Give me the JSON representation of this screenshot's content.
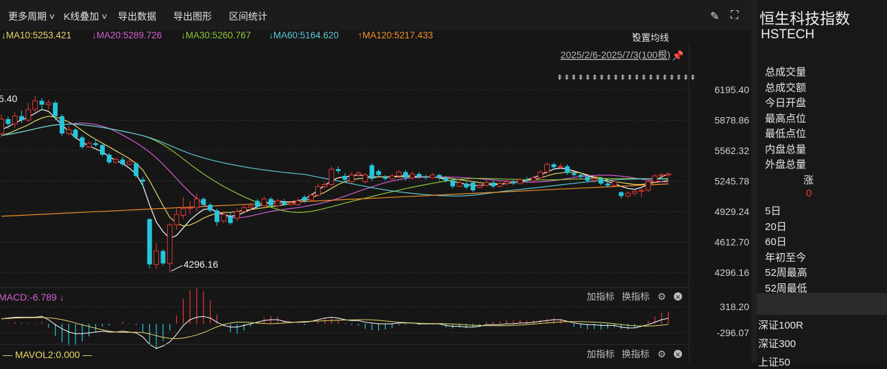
{
  "toolbar": {
    "more_period": "更多周期",
    "kline_overlay": "K线叠加",
    "export_data": "导出数据",
    "export_chart": "导出图形",
    "range_stats": "区间统计"
  },
  "ma_legend": [
    {
      "label": "MA10:5253.421",
      "arrow": "↓",
      "color": "#e8d86a"
    },
    {
      "label": "MA20:5289.726",
      "arrow": "↓",
      "color": "#d45fd4"
    },
    {
      "label": "MA30:5260.767",
      "arrow": "↓",
      "color": "#8fc63a"
    },
    {
      "label": "MA60:5164.620",
      "arrow": "↓",
      "color": "#5cc8d6"
    },
    {
      "label": "MA120:5217.433",
      "arrow": "↑",
      "color": "#f0902a"
    }
  ],
  "settings_ma": "设置均线",
  "date_range": "2025/2/6-2025/7/3(100根)",
  "marker_row": "⇞⇞⇞⇞⇞⇞⇞⇞⇞⇞⇞⇞⇞⇞⇞⇞⇞⇞⇞⇞",
  "chart_data": {
    "type": "candlestick",
    "y_ticks": [
      "6195.40",
      "5878.86",
      "5562.32",
      "5245.78",
      "4929.24",
      "4612.70",
      "4296.16"
    ],
    "ylim": [
      4296.16,
      6195.4
    ],
    "high_label": "5.40",
    "low_label": "4296.16",
    "candles": [
      [
        5740,
        5890,
        5940,
        5700
      ],
      [
        5890,
        5840,
        5920,
        5790
      ],
      [
        5840,
        5920,
        5960,
        5800
      ],
      [
        5920,
        5880,
        5980,
        5850
      ],
      [
        5880,
        5990,
        6060,
        5860
      ],
      [
        5990,
        6080,
        6130,
        5960
      ],
      [
        6080,
        6040,
        6110,
        5990
      ],
      [
        6040,
        6060,
        6090,
        5990
      ],
      [
        6060,
        5920,
        6080,
        5880
      ],
      [
        5920,
        5740,
        5940,
        5710
      ],
      [
        5740,
        5780,
        5820,
        5720
      ],
      [
        5780,
        5700,
        5800,
        5680
      ],
      [
        5700,
        5600,
        5720,
        5580
      ],
      [
        5600,
        5640,
        5660,
        5590
      ],
      [
        5640,
        5620,
        5680,
        5600
      ],
      [
        5620,
        5520,
        5640,
        5500
      ],
      [
        5520,
        5440,
        5540,
        5420
      ],
      [
        5440,
        5470,
        5490,
        5430
      ],
      [
        5470,
        5420,
        5500,
        5400
      ],
      [
        5420,
        5450,
        5480,
        5410
      ],
      [
        5430,
        5300,
        5440,
        5280
      ],
      [
        5260,
        5240,
        5290,
        5180
      ],
      [
        4850,
        4380,
        4860,
        4340
      ],
      [
        4380,
        4520,
        4600,
        4330
      ],
      [
        4520,
        4390,
        4540,
        4370
      ],
      [
        4390,
        4790,
        4810,
        4296
      ],
      [
        4790,
        4900,
        4960,
        4740
      ],
      [
        4890,
        4960,
        5080,
        4850
      ],
      [
        4960,
        4970,
        5040,
        4900
      ],
      [
        4970,
        5060,
        5120,
        4930
      ],
      [
        5060,
        5000,
        5080,
        4980
      ],
      [
        5000,
        4940,
        5020,
        4920
      ],
      [
        4940,
        4820,
        4960,
        4780
      ],
      [
        4830,
        4900,
        4930,
        4810
      ],
      [
        4880,
        4810,
        4920,
        4790
      ],
      [
        4860,
        4930,
        4960,
        4830
      ],
      [
        4930,
        4970,
        5010,
        4920
      ],
      [
        4970,
        4990,
        5020,
        4940
      ],
      [
        5040,
        4980,
        5060,
        4960
      ],
      [
        4990,
        5060,
        5090,
        4960
      ],
      [
        5060,
        4990,
        5080,
        4980
      ],
      [
        4990,
        5040,
        5060,
        4970
      ],
      [
        5030,
        5000,
        5060,
        4990
      ],
      [
        5000,
        5020,
        5040,
        4990
      ],
      [
        5000,
        5040,
        5070,
        4990
      ],
      [
        5080,
        5040,
        5100,
        5020
      ],
      [
        5050,
        5100,
        5120,
        5030
      ],
      [
        5100,
        5190,
        5220,
        5080
      ],
      [
        5190,
        5210,
        5240,
        5170
      ],
      [
        5210,
        5370,
        5400,
        5190
      ],
      [
        5370,
        5350,
        5400,
        5320
      ],
      [
        5300,
        5260,
        5330,
        5240
      ],
      [
        5240,
        5310,
        5340,
        5220
      ],
      [
        5310,
        5330,
        5350,
        5290
      ],
      [
        5240,
        5310,
        5330,
        5220
      ],
      [
        5410,
        5270,
        5430,
        5250
      ],
      [
        5350,
        5310,
        5370,
        5290
      ],
      [
        5290,
        5270,
        5310,
        5250
      ],
      [
        5270,
        5300,
        5320,
        5250
      ],
      [
        5300,
        5340,
        5360,
        5280
      ],
      [
        5340,
        5280,
        5360,
        5250
      ],
      [
        5280,
        5320,
        5340,
        5260
      ],
      [
        5320,
        5290,
        5340,
        5270
      ],
      [
        5290,
        5280,
        5310,
        5260
      ],
      [
        5280,
        5310,
        5330,
        5270
      ],
      [
        5310,
        5280,
        5320,
        5250
      ],
      [
        5280,
        5250,
        5300,
        5230
      ],
      [
        5250,
        5190,
        5270,
        5170
      ],
      [
        5190,
        5230,
        5250,
        5180
      ],
      [
        5220,
        5180,
        5240,
        5160
      ],
      [
        5230,
        5150,
        5240,
        5130
      ],
      [
        5180,
        5200,
        5220,
        5170
      ],
      [
        5200,
        5230,
        5260,
        5190
      ],
      [
        5230,
        5190,
        5250,
        5170
      ],
      [
        5190,
        5220,
        5240,
        5180
      ],
      [
        5220,
        5240,
        5260,
        5200
      ],
      [
        5240,
        5220,
        5260,
        5200
      ],
      [
        5220,
        5260,
        5280,
        5210
      ],
      [
        5260,
        5250,
        5290,
        5230
      ],
      [
        5250,
        5280,
        5300,
        5240
      ],
      [
        5280,
        5340,
        5360,
        5270
      ],
      [
        5340,
        5420,
        5440,
        5320
      ],
      [
        5420,
        5390,
        5440,
        5370
      ],
      [
        5390,
        5400,
        5430,
        5380
      ],
      [
        5400,
        5330,
        5420,
        5310
      ],
      [
        5330,
        5310,
        5350,
        5290
      ],
      [
        5310,
        5290,
        5330,
        5270
      ],
      [
        5290,
        5250,
        5310,
        5230
      ],
      [
        5250,
        5270,
        5290,
        5230
      ],
      [
        5270,
        5220,
        5290,
        5200
      ],
      [
        5220,
        5200,
        5240,
        5180
      ],
      [
        5200,
        5240,
        5260,
        5180
      ],
      [
        5130,
        5090,
        5140,
        5060
      ],
      [
        5090,
        5120,
        5140,
        5070
      ],
      [
        5120,
        5140,
        5160,
        5090
      ],
      [
        5140,
        5150,
        5170,
        5080
      ],
      [
        5150,
        5240,
        5270,
        5130
      ],
      [
        5240,
        5300,
        5320,
        5220
      ],
      [
        5300,
        5310,
        5330,
        5280
      ],
      [
        5310,
        5320,
        5340,
        5290
      ]
    ],
    "ma_series": {
      "MA5": [
        5780,
        5810,
        5850,
        5880,
        5910,
        5950,
        5990,
        5970,
        5900,
        5830,
        5760,
        5700,
        5650,
        5610,
        5580,
        5550,
        5500,
        5460,
        5430,
        5380,
        5320,
        5200,
        5000,
        4820,
        4720,
        4650,
        4680,
        4760,
        4840,
        4900,
        4950,
        4960,
        4930,
        4900,
        4880,
        4890,
        4920,
        4950,
        4980,
        5010,
        5030,
        5040,
        5030,
        5030,
        5040,
        5060,
        5100,
        5150,
        5200,
        5250,
        5280,
        5290,
        5300,
        5310,
        5300,
        5290,
        5290,
        5290,
        5290,
        5300,
        5300,
        5300,
        5290,
        5290,
        5290,
        5280,
        5260,
        5240,
        5230,
        5210,
        5200,
        5200,
        5210,
        5210,
        5210,
        5220,
        5230,
        5250,
        5260,
        5280,
        5310,
        5340,
        5370,
        5380,
        5370,
        5350,
        5330,
        5300,
        5280,
        5260,
        5240,
        5220,
        5190,
        5170,
        5160,
        5180,
        5210,
        5250,
        5290,
        5320
      ],
      "MA10": [
        5720,
        5740,
        5770,
        5800,
        5830,
        5870,
        5900,
        5920,
        5910,
        5890,
        5860,
        5820,
        5770,
        5720,
        5680,
        5640,
        5600,
        5560,
        5520,
        5480,
        5430,
        5360,
        5250,
        5120,
        4990,
        4870,
        4810,
        4780,
        4790,
        4820,
        4860,
        4890,
        4910,
        4920,
        4920,
        4930,
        4940,
        4950,
        4960,
        4970,
        4980,
        4990,
        5000,
        5010,
        5020,
        5040,
        5070,
        5100,
        5130,
        5170,
        5210,
        5240,
        5260,
        5270,
        5280,
        5280,
        5290,
        5290,
        5290,
        5290,
        5290,
        5290,
        5290,
        5290,
        5290,
        5280,
        5280,
        5270,
        5260,
        5250,
        5240,
        5230,
        5220,
        5220,
        5220,
        5220,
        5230,
        5240,
        5250,
        5260,
        5280,
        5300,
        5320,
        5330,
        5340,
        5340,
        5330,
        5310,
        5290,
        5280,
        5260,
        5240,
        5230,
        5220,
        5210,
        5210,
        5220,
        5230,
        5240,
        5253
      ]
    },
    "macd_ticks": [
      "318.20",
      "-296.07"
    ],
    "macd_label": "MACD:-6.789",
    "macd_arrow": "↓",
    "vol_label": "MAVOL2:0.000"
  },
  "sub_controls": {
    "add_indicator": "加指标",
    "switch_indicator": "换指标"
  },
  "right_panel": {
    "title": "恒生科技指数",
    "code": "HSTECH",
    "stats": [
      "总成交量",
      "总成交额",
      "今日开盘",
      "最高点位",
      "最低点位",
      "内盘总量",
      "外盘总量"
    ],
    "change_label": "涨",
    "change_value": "0",
    "periods": [
      "5日",
      "20日",
      "60日",
      "年初至今",
      "52周最高",
      "52周最低"
    ],
    "indices": [
      "深证100R",
      "深证300",
      "上证50"
    ]
  }
}
